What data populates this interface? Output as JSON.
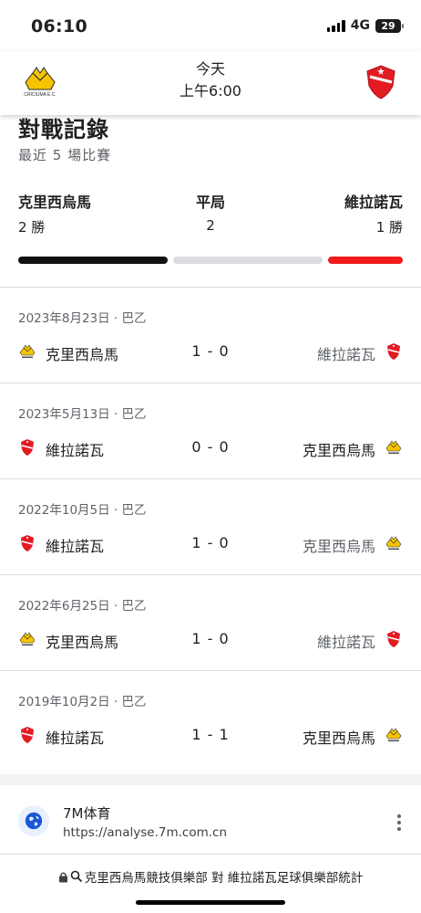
{
  "status_bar": {
    "time": "06:10",
    "network": "4G",
    "battery": "29"
  },
  "header": {
    "day": "今天",
    "time": "上午6:00",
    "home_crest_icon": "criciuma-crest-icon",
    "home_crest_text": "CRICIUMA E.C.",
    "away_crest_icon": "vila-nova-crest-icon"
  },
  "h2h": {
    "title": "對戰記錄",
    "subtitle": "最近 5 場比賽",
    "home_name": "克里西烏馬",
    "draw_label": "平局",
    "away_name": "維拉諾瓦",
    "home_wins": "2 勝",
    "draws": "2",
    "away_wins": "1 勝",
    "home_win_count": 2,
    "draw_count": 2,
    "away_win_count": 1,
    "colors": {
      "home": "#111111",
      "draw": "#dadce0",
      "away": "#f21b1b"
    }
  },
  "matches": [
    {
      "date": "2023年8月23日 · 巴乙",
      "left_team": "克里西烏馬",
      "left_crest": "criciuma-crest-icon",
      "score": "1 - 0",
      "right_team": "維拉諾瓦",
      "right_crest": "vila-nova-crest-icon",
      "winner": "left"
    },
    {
      "date": "2023年5月13日 · 巴乙",
      "left_team": "維拉諾瓦",
      "left_crest": "vila-nova-crest-icon",
      "score": "0 - 0",
      "right_team": "克里西烏馬",
      "right_crest": "criciuma-crest-icon",
      "winner": "draw"
    },
    {
      "date": "2022年10月5日 · 巴乙",
      "left_team": "維拉諾瓦",
      "left_crest": "vila-nova-crest-icon",
      "score": "1 - 0",
      "right_team": "克里西烏馬",
      "right_crest": "criciuma-crest-icon",
      "winner": "left"
    },
    {
      "date": "2022年6月25日 · 巴乙",
      "left_team": "克里西烏馬",
      "left_crest": "criciuma-crest-icon",
      "score": "1 - 0",
      "right_team": "維拉諾瓦",
      "right_crest": "vila-nova-crest-icon",
      "winner": "left"
    },
    {
      "date": "2019年10月2日 · 巴乙",
      "left_team": "維拉諾瓦",
      "left_crest": "vila-nova-crest-icon",
      "score": "1 - 1",
      "right_team": "克里西烏馬",
      "right_crest": "criciuma-crest-icon",
      "winner": "draw"
    }
  ],
  "source": {
    "name": "7M体育",
    "url": "https://analyse.7m.com.cn",
    "icon": "globe-icon",
    "menu_icon": "more-vert-icon"
  },
  "address_bar": {
    "text": "克里西烏馬競技俱樂部 對 維拉諾瓦足球俱樂部統計",
    "lock_icon": "lock-icon",
    "search_icon": "search-icon"
  }
}
